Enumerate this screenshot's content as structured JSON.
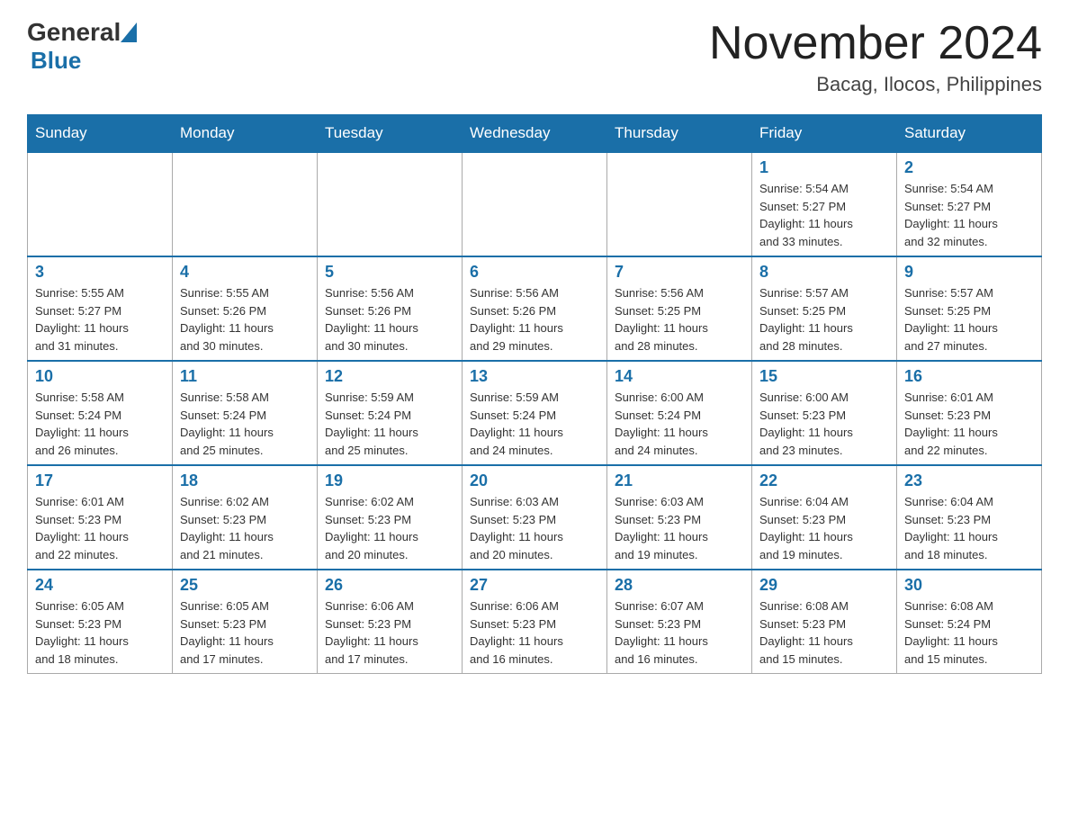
{
  "header": {
    "logo_general": "General",
    "logo_blue": "Blue",
    "month_title": "November 2024",
    "location": "Bacag, Ilocos, Philippines"
  },
  "days_of_week": [
    "Sunday",
    "Monday",
    "Tuesday",
    "Wednesday",
    "Thursday",
    "Friday",
    "Saturday"
  ],
  "weeks": [
    {
      "days": [
        {
          "num": "",
          "info": ""
        },
        {
          "num": "",
          "info": ""
        },
        {
          "num": "",
          "info": ""
        },
        {
          "num": "",
          "info": ""
        },
        {
          "num": "",
          "info": ""
        },
        {
          "num": "1",
          "info": "Sunrise: 5:54 AM\nSunset: 5:27 PM\nDaylight: 11 hours\nand 33 minutes."
        },
        {
          "num": "2",
          "info": "Sunrise: 5:54 AM\nSunset: 5:27 PM\nDaylight: 11 hours\nand 32 minutes."
        }
      ]
    },
    {
      "days": [
        {
          "num": "3",
          "info": "Sunrise: 5:55 AM\nSunset: 5:27 PM\nDaylight: 11 hours\nand 31 minutes."
        },
        {
          "num": "4",
          "info": "Sunrise: 5:55 AM\nSunset: 5:26 PM\nDaylight: 11 hours\nand 30 minutes."
        },
        {
          "num": "5",
          "info": "Sunrise: 5:56 AM\nSunset: 5:26 PM\nDaylight: 11 hours\nand 30 minutes."
        },
        {
          "num": "6",
          "info": "Sunrise: 5:56 AM\nSunset: 5:26 PM\nDaylight: 11 hours\nand 29 minutes."
        },
        {
          "num": "7",
          "info": "Sunrise: 5:56 AM\nSunset: 5:25 PM\nDaylight: 11 hours\nand 28 minutes."
        },
        {
          "num": "8",
          "info": "Sunrise: 5:57 AM\nSunset: 5:25 PM\nDaylight: 11 hours\nand 28 minutes."
        },
        {
          "num": "9",
          "info": "Sunrise: 5:57 AM\nSunset: 5:25 PM\nDaylight: 11 hours\nand 27 minutes."
        }
      ]
    },
    {
      "days": [
        {
          "num": "10",
          "info": "Sunrise: 5:58 AM\nSunset: 5:24 PM\nDaylight: 11 hours\nand 26 minutes."
        },
        {
          "num": "11",
          "info": "Sunrise: 5:58 AM\nSunset: 5:24 PM\nDaylight: 11 hours\nand 25 minutes."
        },
        {
          "num": "12",
          "info": "Sunrise: 5:59 AM\nSunset: 5:24 PM\nDaylight: 11 hours\nand 25 minutes."
        },
        {
          "num": "13",
          "info": "Sunrise: 5:59 AM\nSunset: 5:24 PM\nDaylight: 11 hours\nand 24 minutes."
        },
        {
          "num": "14",
          "info": "Sunrise: 6:00 AM\nSunset: 5:24 PM\nDaylight: 11 hours\nand 24 minutes."
        },
        {
          "num": "15",
          "info": "Sunrise: 6:00 AM\nSunset: 5:23 PM\nDaylight: 11 hours\nand 23 minutes."
        },
        {
          "num": "16",
          "info": "Sunrise: 6:01 AM\nSunset: 5:23 PM\nDaylight: 11 hours\nand 22 minutes."
        }
      ]
    },
    {
      "days": [
        {
          "num": "17",
          "info": "Sunrise: 6:01 AM\nSunset: 5:23 PM\nDaylight: 11 hours\nand 22 minutes."
        },
        {
          "num": "18",
          "info": "Sunrise: 6:02 AM\nSunset: 5:23 PM\nDaylight: 11 hours\nand 21 minutes."
        },
        {
          "num": "19",
          "info": "Sunrise: 6:02 AM\nSunset: 5:23 PM\nDaylight: 11 hours\nand 20 minutes."
        },
        {
          "num": "20",
          "info": "Sunrise: 6:03 AM\nSunset: 5:23 PM\nDaylight: 11 hours\nand 20 minutes."
        },
        {
          "num": "21",
          "info": "Sunrise: 6:03 AM\nSunset: 5:23 PM\nDaylight: 11 hours\nand 19 minutes."
        },
        {
          "num": "22",
          "info": "Sunrise: 6:04 AM\nSunset: 5:23 PM\nDaylight: 11 hours\nand 19 minutes."
        },
        {
          "num": "23",
          "info": "Sunrise: 6:04 AM\nSunset: 5:23 PM\nDaylight: 11 hours\nand 18 minutes."
        }
      ]
    },
    {
      "days": [
        {
          "num": "24",
          "info": "Sunrise: 6:05 AM\nSunset: 5:23 PM\nDaylight: 11 hours\nand 18 minutes."
        },
        {
          "num": "25",
          "info": "Sunrise: 6:05 AM\nSunset: 5:23 PM\nDaylight: 11 hours\nand 17 minutes."
        },
        {
          "num": "26",
          "info": "Sunrise: 6:06 AM\nSunset: 5:23 PM\nDaylight: 11 hours\nand 17 minutes."
        },
        {
          "num": "27",
          "info": "Sunrise: 6:06 AM\nSunset: 5:23 PM\nDaylight: 11 hours\nand 16 minutes."
        },
        {
          "num": "28",
          "info": "Sunrise: 6:07 AM\nSunset: 5:23 PM\nDaylight: 11 hours\nand 16 minutes."
        },
        {
          "num": "29",
          "info": "Sunrise: 6:08 AM\nSunset: 5:23 PM\nDaylight: 11 hours\nand 15 minutes."
        },
        {
          "num": "30",
          "info": "Sunrise: 6:08 AM\nSunset: 5:24 PM\nDaylight: 11 hours\nand 15 minutes."
        }
      ]
    }
  ]
}
